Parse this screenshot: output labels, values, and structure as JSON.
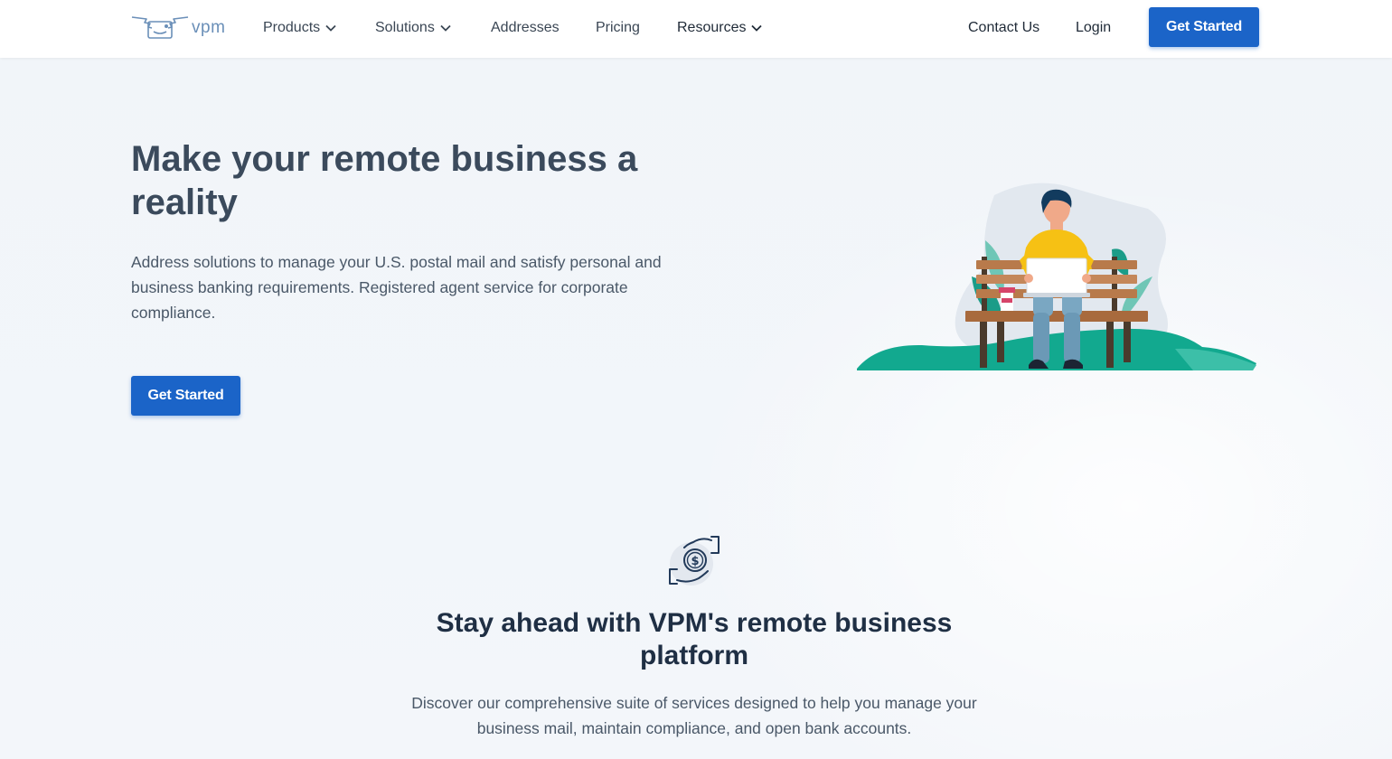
{
  "header": {
    "logo_text": "vpm",
    "nav": [
      {
        "label": "Products",
        "dropdown": true
      },
      {
        "label": "Solutions",
        "dropdown": true
      },
      {
        "label": "Addresses",
        "dropdown": false
      },
      {
        "label": "Pricing",
        "dropdown": false
      },
      {
        "label": "Resources",
        "dropdown": true
      }
    ],
    "contact_label": "Contact Us",
    "login_label": "Login",
    "cta_label": "Get Started"
  },
  "hero": {
    "title": "Make your remote business a reality",
    "subtitle": "Address solutions to manage your U.S. postal mail and satisfy personal and business banking requirements. Registered agent service for corporate compliance.",
    "cta_label": "Get Started"
  },
  "section": {
    "icon": "money-exchange-hands-icon",
    "title": "Stay ahead with VPM's remote business platform",
    "subtitle": "Discover our comprehensive suite of services designed to help you manage your business mail, maintain compliance, and open bank accounts."
  },
  "colors": {
    "primary": "#1b64c8",
    "heading": "#1f2f44",
    "logo": "#6a8fb8",
    "teal": "#12a98f",
    "yellow": "#f6c114"
  }
}
